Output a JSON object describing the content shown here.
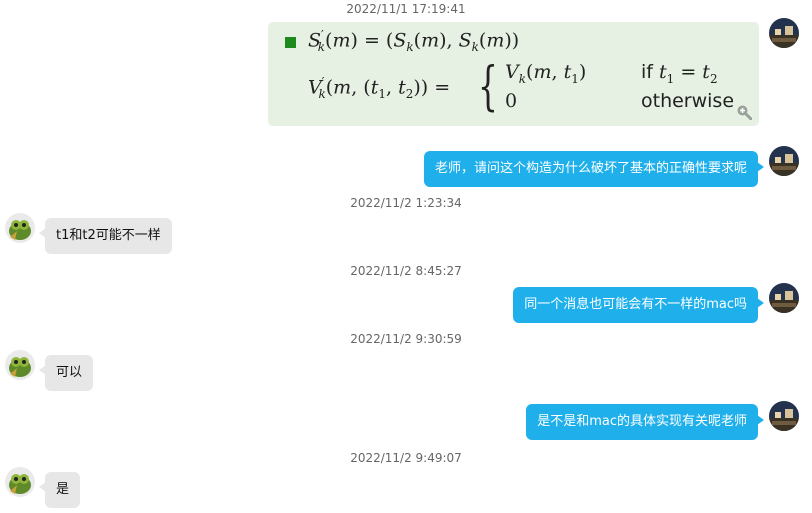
{
  "messages": [
    {
      "timestamp": "2022/11/1 17:19:41"
    },
    {
      "text": "老师，请问这个构造为什么破坏了基本的正确性要求呢"
    },
    {
      "timestamp": "2022/11/2 1:23:34",
      "text": "t1和t2可能不一样"
    },
    {
      "timestamp": "2022/11/2 8:45:27",
      "text": "同一个消息也可能会有不一样的mac吗"
    },
    {
      "timestamp": "2022/11/2 9:30:59",
      "text": "可以"
    },
    {
      "text": "是不是和mac的具体实现有关呢老师"
    },
    {
      "timestamp": "2022/11/2 9:49:07",
      "text": "是"
    }
  ],
  "formula": {
    "case1_cond": "if",
    "case2_value": "0",
    "case2_cond": "otherwise"
  },
  "colors": {
    "outgoing_bubble": "#1fb0ec",
    "incoming_bubble": "#e7e7e7",
    "image_bg": "#e6f0e3",
    "timestamp": "#666666"
  },
  "icons": {
    "zoom": "zoom-in-icon",
    "bullet": "green-square-bullet"
  }
}
